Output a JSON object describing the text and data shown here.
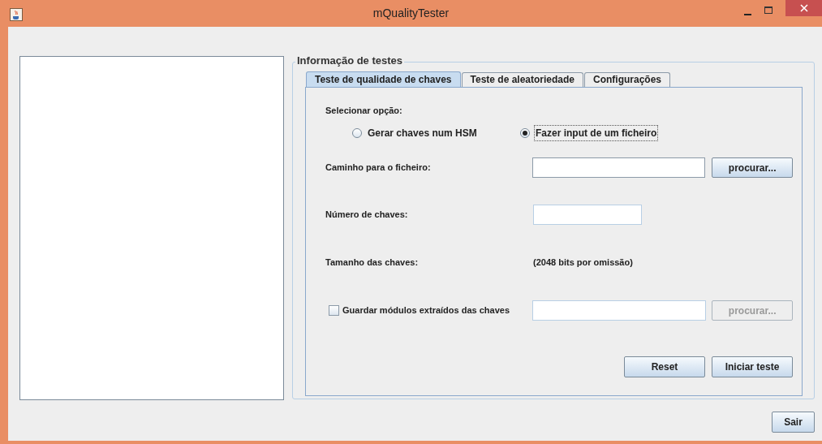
{
  "window": {
    "title": "mQualityTester"
  },
  "group": {
    "title": "Informação de testes"
  },
  "tabs": [
    {
      "label": "Teste de qualidade de chaves",
      "selected": true
    },
    {
      "label": "Teste de aleatoriedade",
      "selected": false
    },
    {
      "label": "Configurações",
      "selected": false
    }
  ],
  "form": {
    "option_label": "Selecionar opção:",
    "options": [
      {
        "label": "Gerar chaves num HSM",
        "selected": false
      },
      {
        "label": "Fazer input de um ficheiro",
        "selected": true
      }
    ],
    "file_path": {
      "label": "Caminho para o ficheiro:",
      "browse": {
        "label": "procurar...",
        "disabled": false
      }
    },
    "key_count": {
      "label": "Número de chaves:"
    },
    "key_size": {
      "label": "Tamanho das chaves:",
      "value": "(2048 bits por omissão)"
    },
    "save_modules": {
      "label": "Guardar módulos extraídos das chaves",
      "checked": false,
      "browse": {
        "label": "procurar...",
        "disabled": true
      }
    },
    "buttons": [
      "Reset",
      "Iniciar teste"
    ]
  },
  "exit_button": "Sair"
}
